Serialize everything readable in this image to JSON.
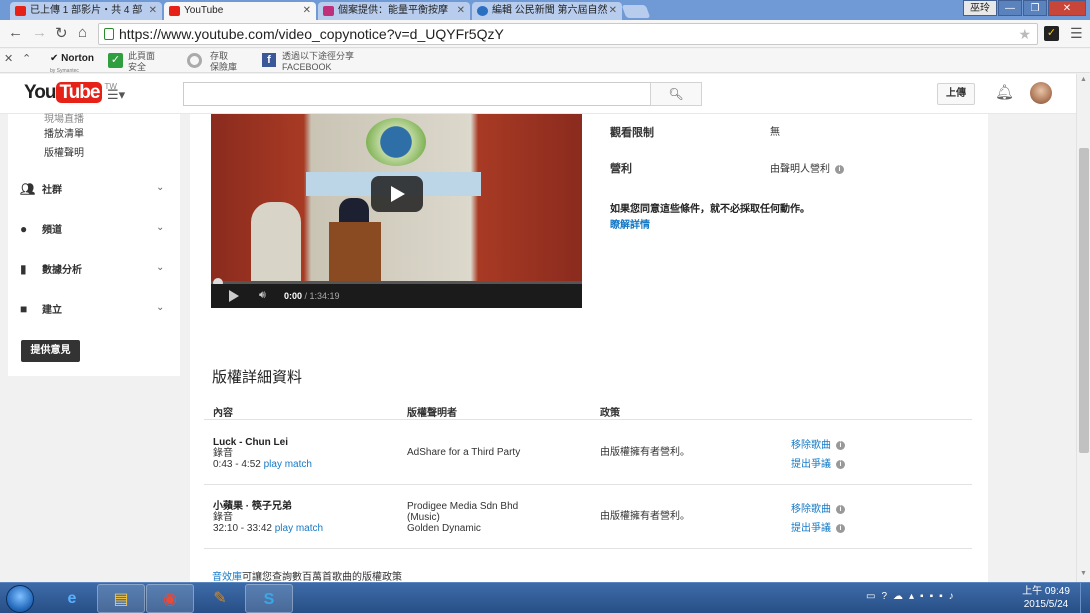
{
  "browser": {
    "tabs": [
      {
        "label": "已上傳 1 部影片・共 4 部",
        "favicon_color": "#e62117"
      },
      {
        "label": "YouTube",
        "favicon_color": "#e62117",
        "active": true
      },
      {
        "label": "個案提供：能量平衡按摩",
        "favicon_color": "#c0307a"
      },
      {
        "label": "編輯 公民新聞 第六屆自然",
        "favicon_color": "#2a6fc0"
      }
    ],
    "user_button": "巫玲",
    "url": "https://www.youtube.com/video_copynotice?v=d_UQYFr5QzY"
  },
  "norton_bar": {
    "logo": "Norton",
    "logo_sub": "by Symantec",
    "page_status_line1": "此頁面",
    "page_status_line2": "安全",
    "save_line1": "存取",
    "save_line2": "保險庫",
    "share_line1": "透過以下途徑分享",
    "share_line2": "FACEBOOK"
  },
  "masthead": {
    "logo_you": "You",
    "logo_tube": "Tube",
    "logo_region": "TW",
    "search_placeholder": "",
    "upload_label": "上傳"
  },
  "guide": {
    "sub_items": [
      "現場直播",
      "播放清單",
      "版權聲明"
    ],
    "sections": [
      {
        "label": "社群",
        "icon": "people-icon"
      },
      {
        "label": "頻道",
        "icon": "person-icon"
      },
      {
        "label": "數據分析",
        "icon": "bar-chart-icon"
      },
      {
        "label": "建立",
        "icon": "video-camera-icon"
      }
    ],
    "feedback_label": "提供意見"
  },
  "video": {
    "current_time": "0:00",
    "duration": "/ 1:34:19",
    "played_fraction": 0
  },
  "restrictions": {
    "viewing_label": "觀看限制",
    "viewing_value": "無",
    "monetization_label": "營利",
    "monetization_value": "由聲明人營利",
    "agree_text": "如果您同意這些條件，就不必採取任何動作。",
    "learn_more": "瞭解詳情"
  },
  "copyright": {
    "title": "版權詳細資料",
    "headers": {
      "content": "內容",
      "claimant": "版權聲明者",
      "policy": "政策"
    },
    "rows": [
      {
        "title": "Luck - Chun Lei",
        "type": "錄音",
        "time": "0:43 - 4:52",
        "match": "play match",
        "claimant_lines": [
          "AdShare for a Third Party"
        ],
        "policy": "由版權擁有者營利。",
        "remove_label": "移除歌曲",
        "dispute_label": "提出爭議"
      },
      {
        "title": "小蘋果 · 筷子兄弟",
        "type": "錄音",
        "time": "32:10 - 33:42",
        "match": "play match",
        "claimant_lines": [
          "Prodigee Media Sdn Bhd",
          "(Music)",
          "Golden Dynamic"
        ],
        "policy": "由版權擁有者營利。",
        "remove_label": "移除歌曲",
        "dispute_label": "提出爭議"
      }
    ],
    "footer_link": "音效庫",
    "footer_text": "可讓您查詢數百萬首歌曲的版權政策"
  },
  "taskbar": {
    "time": "上午 09:49",
    "date": "2015/5/24"
  }
}
